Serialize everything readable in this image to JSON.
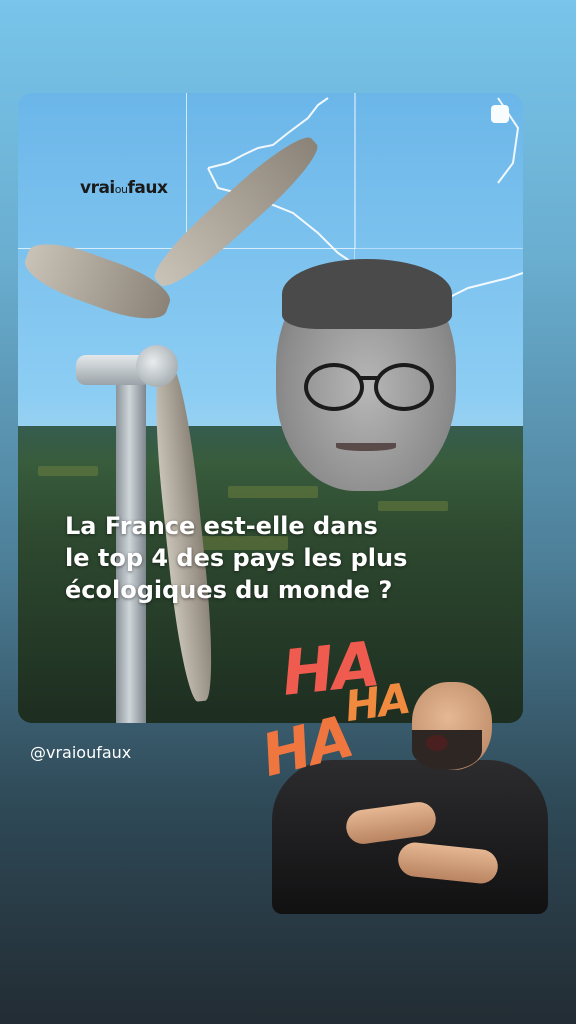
{
  "story_card": {
    "brand_logo_main": "vrai",
    "brand_logo_ou": "ou",
    "brand_logo_end": "faux",
    "headline_line1": "La France est-elle dans",
    "headline_line2": "le top 4 des pays les plus",
    "headline_line3": "écologiques du monde ?"
  },
  "account": {
    "handle": "@vraioufaux"
  },
  "sticker": {
    "ha_1": "HA",
    "ha_2": "HA",
    "ha_3": "HA"
  },
  "colors": {
    "sky": "#78c4ea",
    "bottom": "#222c33",
    "ha_red": "#f05b4f",
    "ha_orange": "#f08a3e"
  },
  "icons": [
    "square-icon"
  ]
}
